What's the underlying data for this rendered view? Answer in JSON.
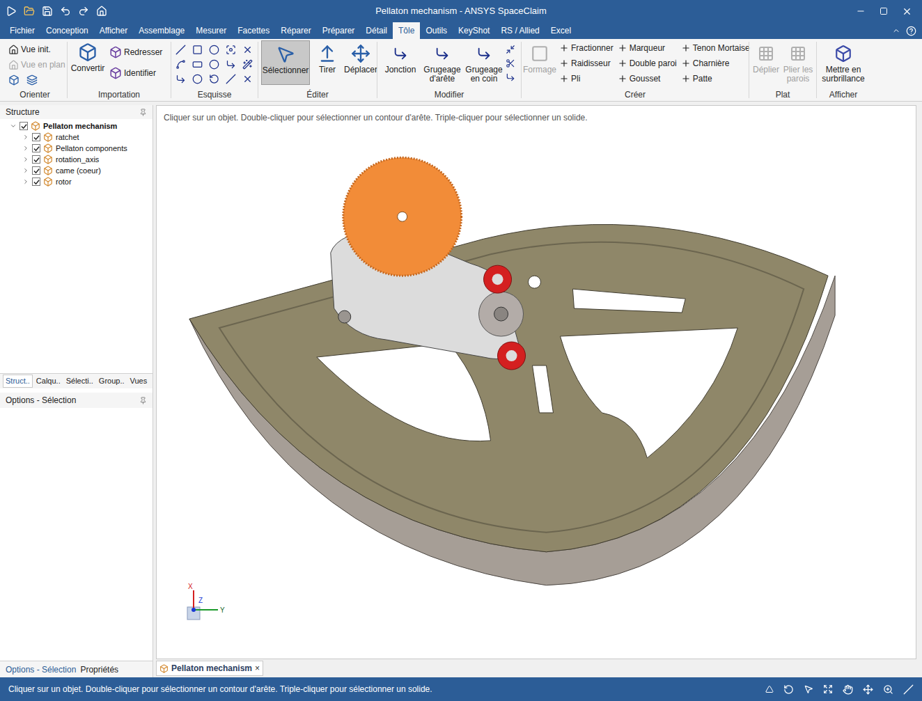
{
  "window": {
    "title": "Pellaton mechanism - ANSYS SpaceClaim"
  },
  "menu_tabs": [
    {
      "label": "Fichier",
      "selected": false
    },
    {
      "label": "Conception",
      "selected": false
    },
    {
      "label": "Afficher",
      "selected": false
    },
    {
      "label": "Assemblage",
      "selected": false
    },
    {
      "label": "Mesurer",
      "selected": false
    },
    {
      "label": "Facettes",
      "selected": false
    },
    {
      "label": "Réparer",
      "selected": false
    },
    {
      "label": "Préparer",
      "selected": false
    },
    {
      "label": "Détail",
      "selected": false
    },
    {
      "label": "Tôle",
      "selected": true
    },
    {
      "label": "Outils",
      "selected": false
    },
    {
      "label": "KeyShot",
      "selected": false
    },
    {
      "label": "RS / Allied",
      "selected": false
    },
    {
      "label": "Excel",
      "selected": false
    }
  ],
  "ribbon": {
    "orienter": {
      "label": "Orienter",
      "items": [
        {
          "label": "Vue init.",
          "disabled": false
        },
        {
          "label": "Vue en plan",
          "disabled": true
        }
      ]
    },
    "importation": {
      "label": "Importation",
      "items": [
        {
          "label": "Convertir"
        },
        {
          "label": "Redresser"
        },
        {
          "label": "Identifier"
        }
      ]
    },
    "esquisse": {
      "label": "Esquisse"
    },
    "editer": {
      "label": "Éditer",
      "items": [
        {
          "label": "Sélectionner",
          "selected": true
        },
        {
          "label": "Tirer",
          "selected": false
        },
        {
          "label": "Déplacer",
          "selected": false
        }
      ]
    },
    "modifier": {
      "label": "Modifier",
      "items": [
        {
          "label": "Jonction"
        },
        {
          "label": "Grugeage d'arête"
        },
        {
          "label": "Grugeage en coin"
        }
      ]
    },
    "creer": {
      "label": "Créer",
      "large": {
        "label": "Formage",
        "disabled": true
      },
      "items": [
        {
          "label": "Fractionner"
        },
        {
          "label": "Raidisseur"
        },
        {
          "label": "Pli"
        },
        {
          "label": "Marqueur"
        },
        {
          "label": "Double paroi"
        },
        {
          "label": "Gousset"
        },
        {
          "label": "Tenon Mortaise"
        },
        {
          "label": "Charnière"
        },
        {
          "label": "Patte"
        }
      ]
    },
    "plat": {
      "label": "Plat",
      "items": [
        {
          "label": "Déplier",
          "disabled": true
        },
        {
          "label": "Plier les parois",
          "disabled": true
        }
      ]
    },
    "afficher": {
      "label": "Afficher",
      "items": [
        {
          "label": "Mettre en surbrillance"
        }
      ]
    }
  },
  "structure": {
    "title": "Structure",
    "tree": [
      {
        "label": "Pellaton mechanism",
        "checked": true,
        "expanded": true,
        "root": true
      },
      {
        "label": "ratchet",
        "checked": true,
        "expanded": false,
        "root": false
      },
      {
        "label": "Pellaton components",
        "checked": true,
        "expanded": false,
        "root": false
      },
      {
        "label": "rotation_axis",
        "checked": true,
        "expanded": false,
        "root": false
      },
      {
        "label": "came (coeur)",
        "checked": true,
        "expanded": false,
        "root": false
      },
      {
        "label": "rotor",
        "checked": true,
        "expanded": false,
        "root": false
      }
    ]
  },
  "panel_tabs": [
    {
      "label": "Struct..",
      "selected": true
    },
    {
      "label": "Calqu..",
      "selected": false
    },
    {
      "label": "Sélecti..",
      "selected": false
    },
    {
      "label": "Group..",
      "selected": false
    },
    {
      "label": "Vues",
      "selected": false
    }
  ],
  "options_panel": {
    "title": "Options - Sélection"
  },
  "bottom_tabs": [
    {
      "label": "Options - Sélection",
      "selected": true
    },
    {
      "label": "Propriétés",
      "selected": false
    }
  ],
  "viewport": {
    "hint": "Cliquer sur un objet. Double-cliquer pour sélectionner un contour d'arête. Triple-cliquer pour sélectionner un solide.",
    "axes": {
      "x": "X",
      "y": "Y",
      "z": "Z"
    }
  },
  "document_tab": {
    "label": "Pellaton mechanism",
    "close": "×"
  },
  "status_bar": {
    "text": "Cliquer sur un objet. Double-cliquer pour sélectionner un contour d'arête. Triple-cliquer pour sélectionner un solide."
  }
}
